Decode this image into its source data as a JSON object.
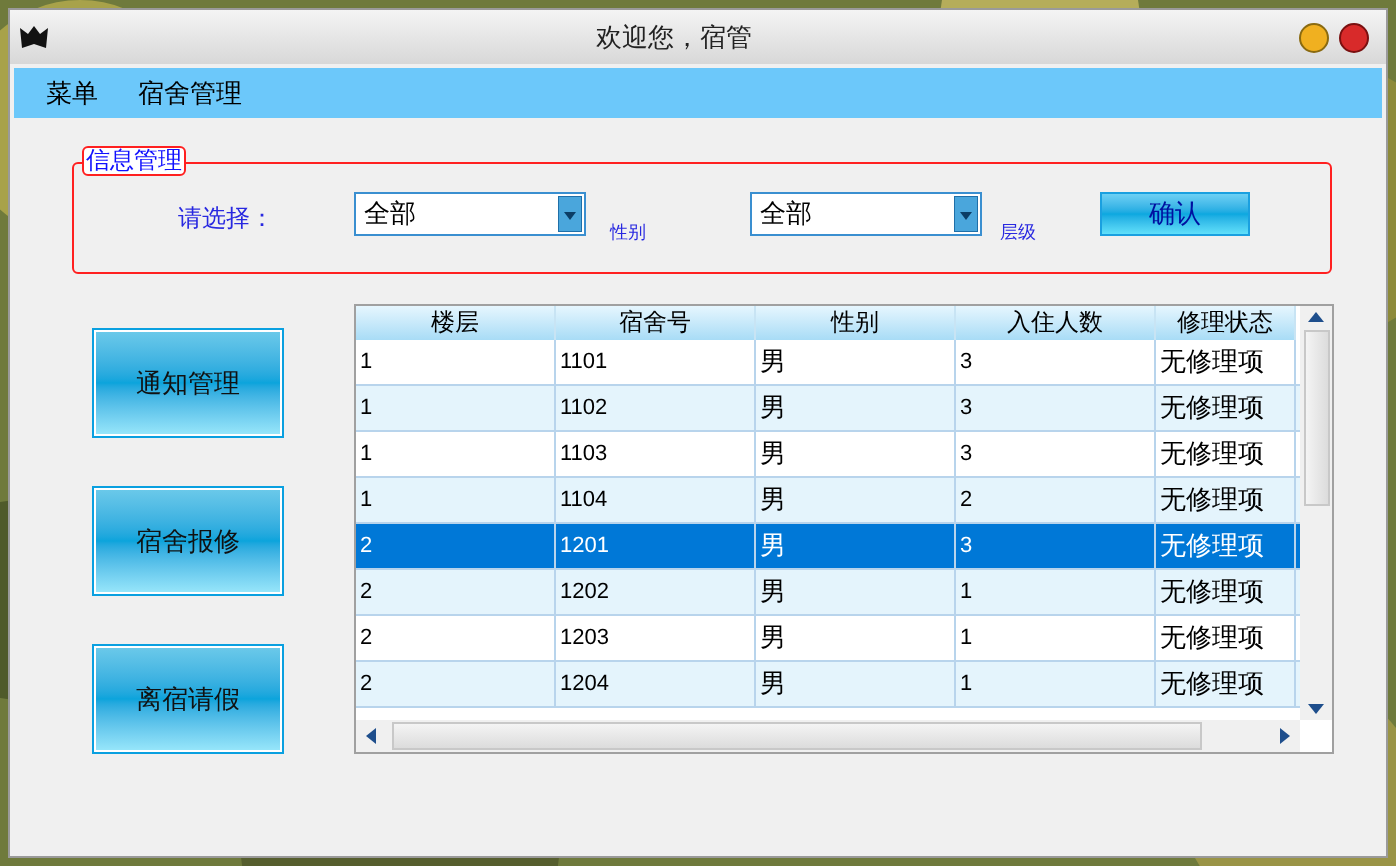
{
  "window": {
    "title": "欢迎您，宿管"
  },
  "menu": [
    "菜单",
    "宿舍管理"
  ],
  "filter_group": {
    "title": "信息管理",
    "prompt": "请选择：",
    "gender_select": {
      "value": "全部"
    },
    "gender_label": "性别",
    "floor_select": {
      "value": "全部"
    },
    "floor_label": "层级",
    "confirm_button": "确认"
  },
  "side_buttons": [
    "通知管理",
    "宿舍报修",
    "离宿请假"
  ],
  "table": {
    "columns": [
      "楼层",
      "宿舍号",
      "性别",
      "入住人数",
      "修理状态"
    ],
    "rows": [
      {
        "cells": [
          "1",
          "1101",
          "男",
          "3",
          "无修理项"
        ],
        "selected": false
      },
      {
        "cells": [
          "1",
          "1102",
          "男",
          "3",
          "无修理项"
        ],
        "selected": false
      },
      {
        "cells": [
          "1",
          "1103",
          "男",
          "3",
          "无修理项"
        ],
        "selected": false
      },
      {
        "cells": [
          "1",
          "1104",
          "男",
          "2",
          "无修理项"
        ],
        "selected": false
      },
      {
        "cells": [
          "2",
          "1201",
          "男",
          "3",
          "无修理项"
        ],
        "selected": true
      },
      {
        "cells": [
          "2",
          "1202",
          "男",
          "1",
          "无修理项"
        ],
        "selected": false
      },
      {
        "cells": [
          "2",
          "1203",
          "男",
          "1",
          "无修理项"
        ],
        "selected": false
      },
      {
        "cells": [
          "2",
          "1204",
          "男",
          "1",
          "无修理项"
        ],
        "selected": false
      }
    ]
  }
}
